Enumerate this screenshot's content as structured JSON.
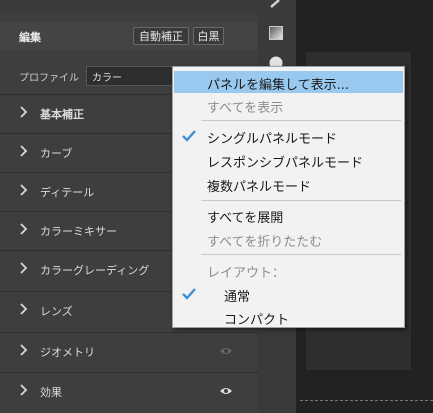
{
  "panel": {
    "header": {
      "title": "編集",
      "auto_label": "自動補正",
      "bw_label": "白黒"
    },
    "profile": {
      "label": "プロファイル",
      "value": "カラー"
    },
    "sections": [
      {
        "label": "基本補正",
        "bold": true
      },
      {
        "label": "カーブ"
      },
      {
        "label": "ディテール"
      },
      {
        "label": "カラーミキサー"
      },
      {
        "label": "カラーグレーディング"
      },
      {
        "label": "レンズ"
      },
      {
        "label": "ジオメトリ",
        "eye": "eye-icon"
      },
      {
        "label": "効果",
        "eye": "eye-icon"
      }
    ]
  },
  "menu": {
    "items": [
      {
        "label": "パネルを編集して表示...",
        "highlighted": true
      },
      {
        "label": "すべてを表示",
        "disabled": true
      },
      {
        "label": "シングルパネルモード",
        "checked": true
      },
      {
        "label": "レスポンシブパネルモード"
      },
      {
        "label": "複数パネルモード"
      },
      {
        "label": "すべてを展開"
      },
      {
        "label": "すべてを折りたたむ",
        "disabled": true
      },
      {
        "label": "レイアウト：",
        "disabled": true
      },
      {
        "label": "通常",
        "checked": true,
        "sub": true
      },
      {
        "label": "コンパクト",
        "sub": true
      }
    ]
  },
  "colors": {
    "highlight": "#99c9ef",
    "check": "#3d8fd8",
    "panel_bg": "#3e3e3e"
  }
}
